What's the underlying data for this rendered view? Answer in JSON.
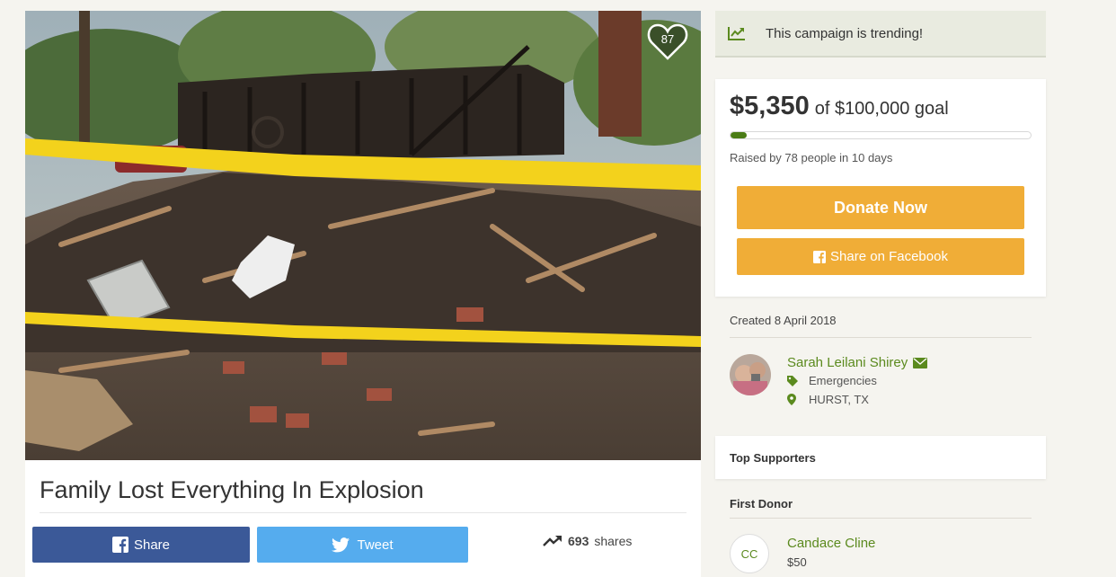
{
  "hero": {
    "likes": "87"
  },
  "campaign": {
    "title": "Family Lost Everything In Explosion"
  },
  "social": {
    "share_label": "Share",
    "tweet_label": "Tweet",
    "share_count": "693",
    "share_suffix": "shares"
  },
  "trending": {
    "text": "This campaign is trending!"
  },
  "funding": {
    "raised": "$5,350",
    "goal_text": "of $100,000 goal",
    "progress_fraction": 0.0535,
    "raised_by": "Raised by 78 people in 10 days",
    "donate_label": "Donate Now",
    "facebook_label": "Share on Facebook"
  },
  "meta": {
    "created": "Created 8 April 2018"
  },
  "organizer": {
    "name": "Sarah Leilani Shirey",
    "category": "Emergencies",
    "location": "HURST, TX"
  },
  "supporters": {
    "heading": "Top Supporters",
    "first_donor_heading": "First Donor",
    "first_donor": {
      "initials": "CC",
      "name": "Candace Cline",
      "amount": "$50"
    }
  },
  "colors": {
    "accent_green": "#5b8a1e",
    "progress": "#4a7c15",
    "donate": "#f0ad37",
    "facebook": "#3b5998",
    "twitter": "#55acee"
  }
}
